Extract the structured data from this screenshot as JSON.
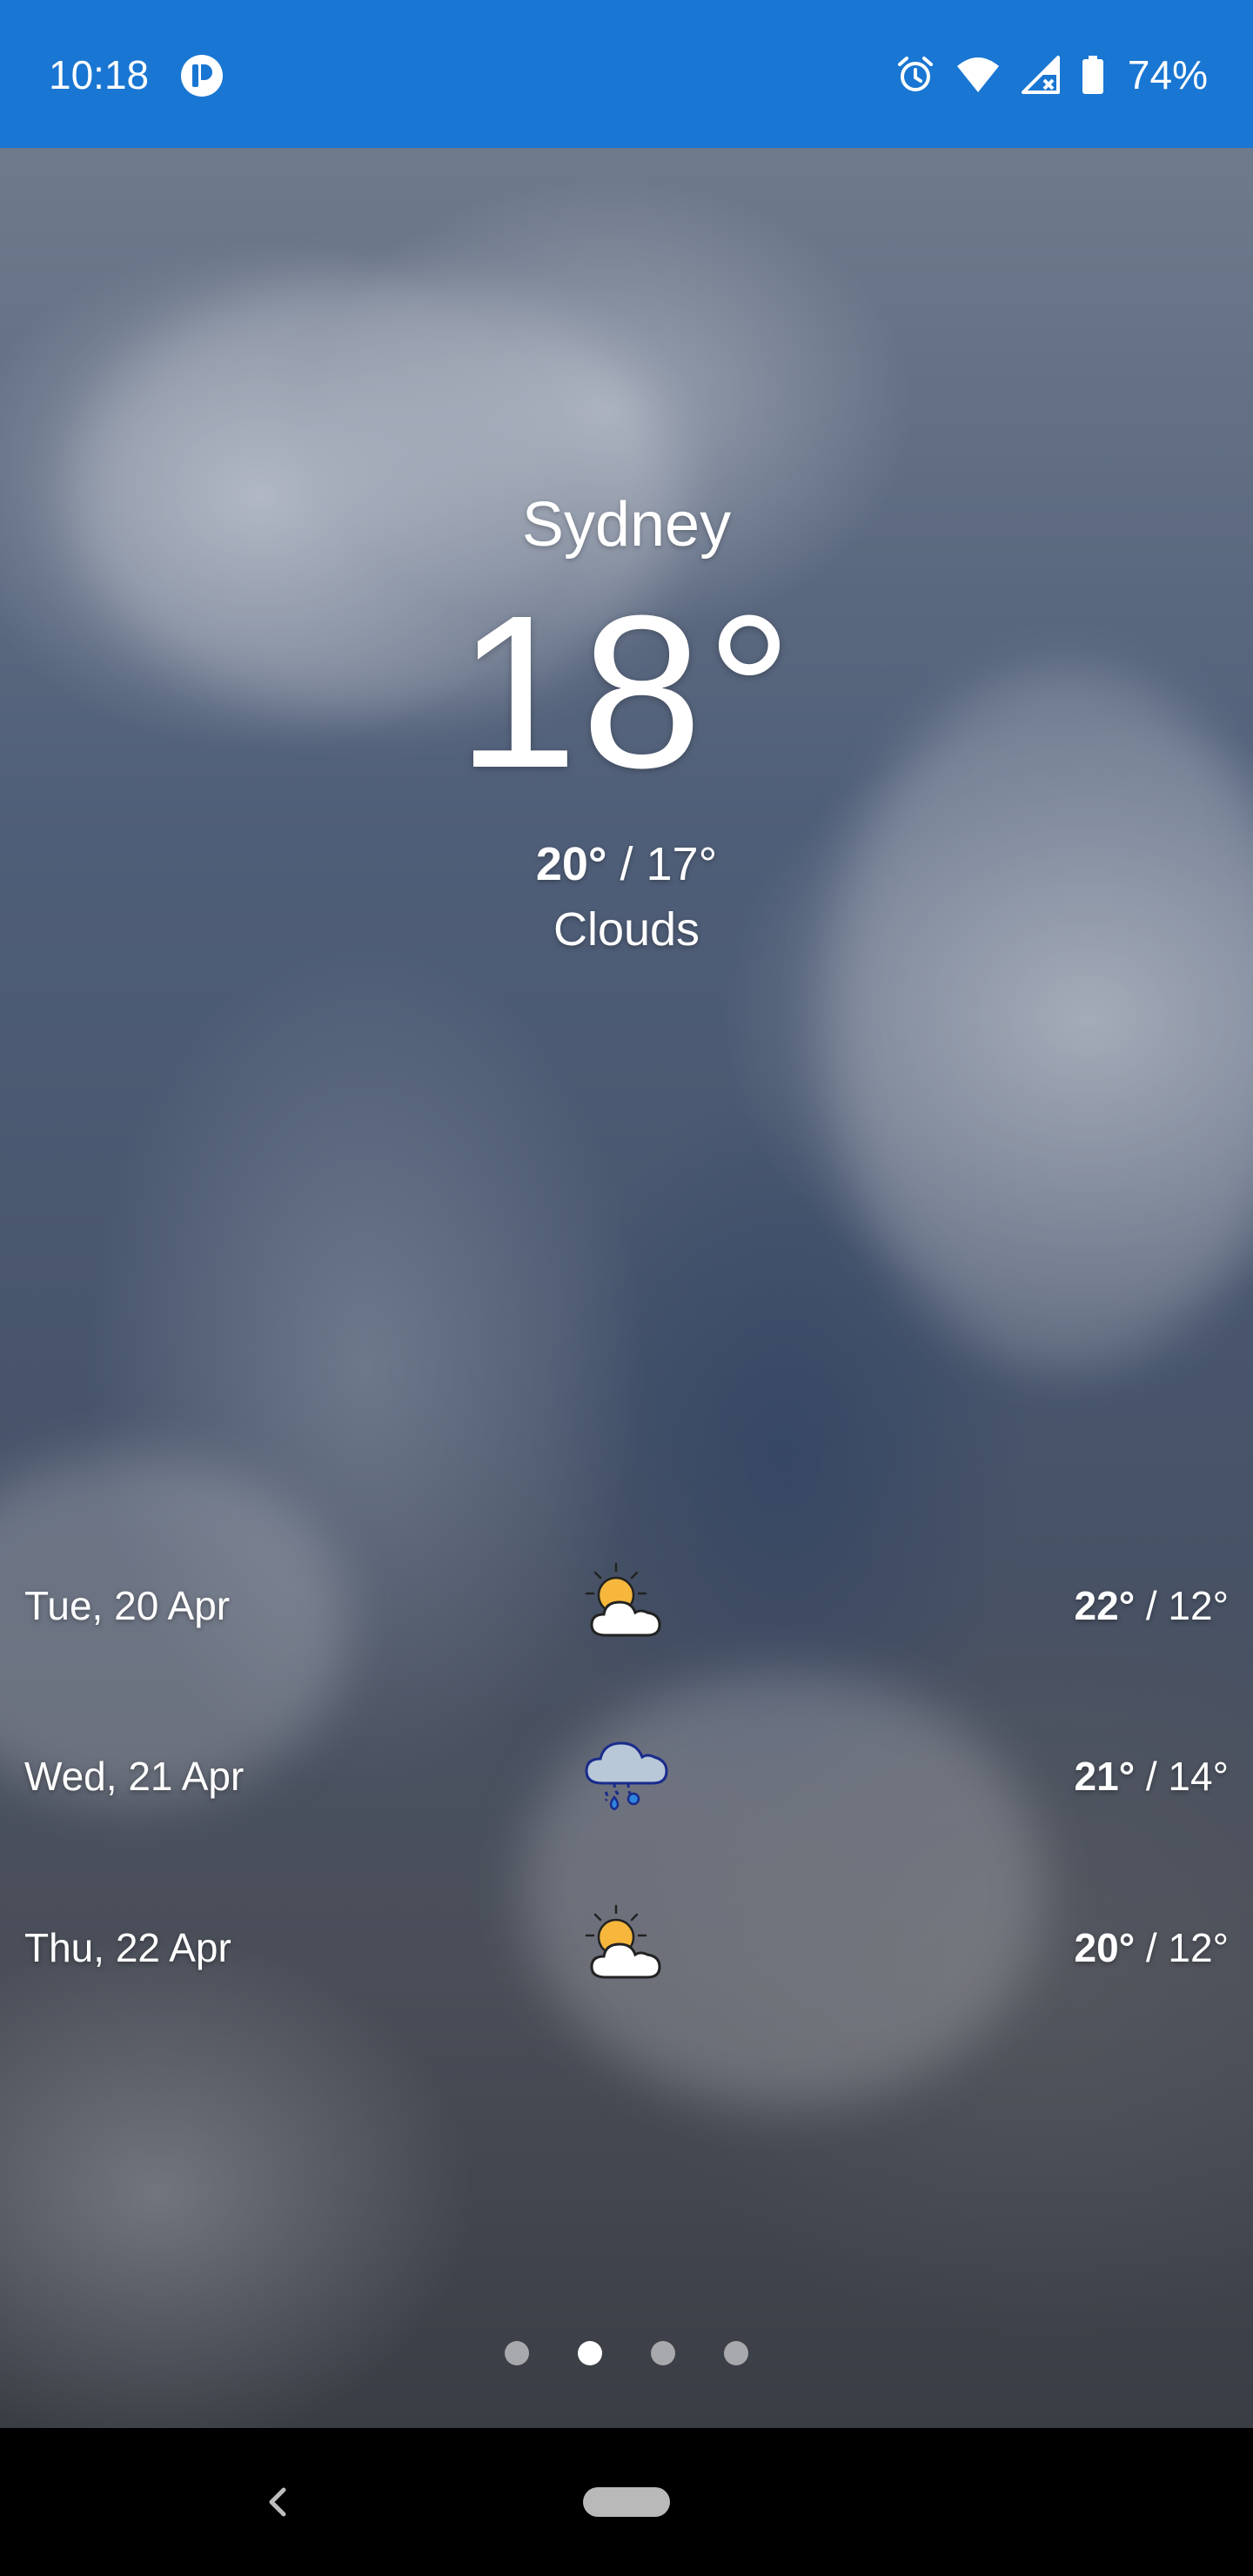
{
  "status_bar": {
    "time": "10:18",
    "battery": "74%",
    "background_color": "#1976d2"
  },
  "weather": {
    "city": "Sydney",
    "temperature": "18°",
    "high": "20°",
    "low_text": " / 17°",
    "condition": "Clouds"
  },
  "forecast": [
    {
      "date": "Tue, 20 Apr",
      "icon": "partly-sunny-icon",
      "high": "22°",
      "low_text": " / 12°"
    },
    {
      "date": "Wed, 21 Apr",
      "icon": "rain-cloud-icon",
      "high": "21°",
      "low_text": " / 14°"
    },
    {
      "date": "Thu, 22 Apr",
      "icon": "partly-sunny-icon",
      "high": "20°",
      "low_text": " / 12°"
    }
  ],
  "pager": {
    "count": 4,
    "active_index": 1
  },
  "nav_bar": {
    "back_icon": "back-chevron-icon",
    "home_icon": "home-pill-icon"
  }
}
